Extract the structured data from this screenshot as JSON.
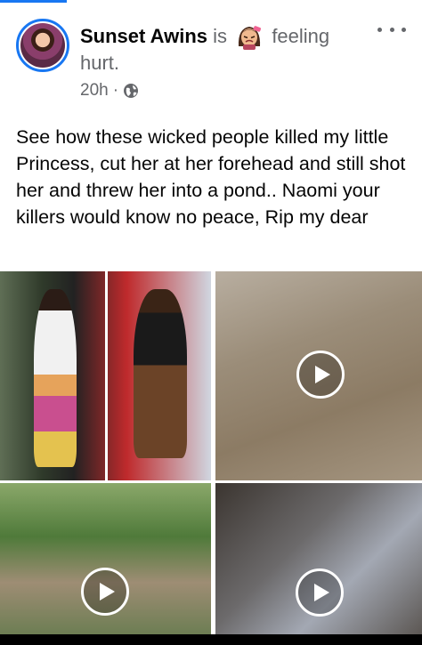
{
  "post": {
    "author": "Sunset Awins",
    "is_word": "is",
    "feeling_word": "feeling",
    "feeling_value": "hurt.",
    "time": "20h",
    "separator": "·",
    "icons": {
      "feeling": "hurt-face-emoji-icon",
      "privacy": "globe-icon",
      "more": "more-options-icon",
      "play": "play-icon"
    },
    "text": "See how these wicked people killed my little Princess, cut her at her forehead and still shot her and threw her into a pond.. Naomi your killers would know no peace, Rip my dear"
  },
  "media": {
    "tiles": [
      {
        "kind": "photo"
      },
      {
        "kind": "video"
      },
      {
        "kind": "video"
      },
      {
        "kind": "video"
      }
    ]
  },
  "colors": {
    "accent": "#1877f2",
    "text": "#050505",
    "secondary_text": "#65676b"
  }
}
